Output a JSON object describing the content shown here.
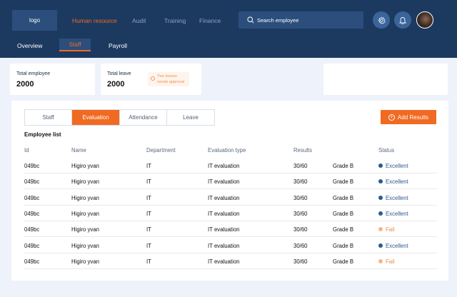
{
  "header": {
    "logo": "logo",
    "nav": [
      "Human resource",
      "Audit",
      "Training",
      "Finance"
    ],
    "search_placeholder": "Search employee"
  },
  "subnav": [
    "Overview",
    "Staff",
    "Payroll"
  ],
  "stats": {
    "total_employee_label": "Total employee",
    "total_employee_value": "2000",
    "total_leave_label": "Total leave",
    "total_leave_value": "2000",
    "leave_badge_line1": "Two leaves",
    "leave_badge_line2": "needs approval"
  },
  "tabs": [
    "Staff",
    "Evaluation",
    "Attendance",
    "Leave"
  ],
  "add_button": "Add Results",
  "list_title": "Employee list",
  "columns": [
    "Id",
    "Name",
    "Department",
    "Evaluation type",
    "Results",
    "Status"
  ],
  "rows": [
    {
      "id": "049bc",
      "name": "Higiro yvan",
      "department": "IT",
      "type": "IT evaluation",
      "score": "30/60",
      "grade": "Grade B",
      "status": "Excellent"
    },
    {
      "id": "049bc",
      "name": "Higiro yvan",
      "department": "IT",
      "type": "IT evaluation",
      "score": "30/60",
      "grade": "Grade B",
      "status": "Excellent"
    },
    {
      "id": "049bc",
      "name": "Higiro yvan",
      "department": "IT",
      "type": "IT evaluation",
      "score": "30/60",
      "grade": "Grade B",
      "status": "Excellent"
    },
    {
      "id": "049bc",
      "name": "Higiro yvan",
      "department": "IT",
      "type": "IT evaluation",
      "score": "30/60",
      "grade": "Grade B",
      "status": "Excellent"
    },
    {
      "id": "049bc",
      "name": "Higiro yvan",
      "department": "IT",
      "type": "IT evaluation",
      "score": "30/60",
      "grade": "Grade B",
      "status": "Fail"
    },
    {
      "id": "049bc",
      "name": "Higiro yvan",
      "department": "IT",
      "type": "IT evaluation",
      "score": "30/60",
      "grade": "Grade B",
      "status": "Excellent"
    },
    {
      "id": "049bc",
      "name": "Higiro yvan",
      "department": "IT",
      "type": "IT evaluation",
      "score": "30/60",
      "grade": "Grade B",
      "status": "Fail"
    }
  ],
  "colors": {
    "header_bg": "#1c3a60",
    "accent": "#f16a21",
    "excellent": "#2e5a8f",
    "fail": "#f7b48a"
  },
  "icons": [
    "search-icon",
    "settings-icon",
    "bell-icon",
    "info-icon",
    "plus-icon"
  ]
}
